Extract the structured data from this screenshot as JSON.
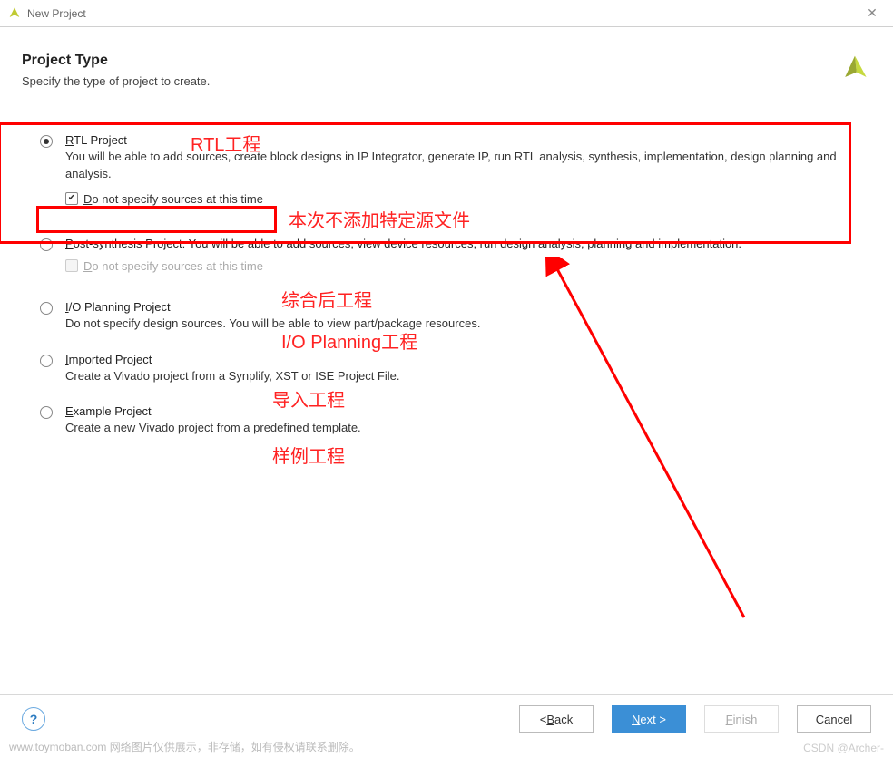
{
  "window": {
    "title": "New Project"
  },
  "header": {
    "title": "Project Type",
    "subtitle": "Specify the type of project to create."
  },
  "options": {
    "rtl": {
      "title_prefix": "R",
      "title_rest": "TL Project",
      "desc": "You will be able to add sources, create block designs in IP Integrator, generate IP, run RTL analysis, synthesis, implementation, design planning and analysis.",
      "checkbox_prefix": "D",
      "checkbox_rest": "o not specify sources at this time",
      "selected": true,
      "checked": true
    },
    "post": {
      "title_prefix": "P",
      "title_rest": "ost-synthesis Project: You will be able to add sources, view device resources, run design analysis, planning and implementation.",
      "checkbox_prefix": "D",
      "checkbox_rest": "o not specify sources at this time"
    },
    "io": {
      "title_prefix": "I",
      "title_rest": "/O Planning Project",
      "desc": "Do not specify design sources. You will be able to view part/package resources."
    },
    "imported": {
      "title_prefix": "I",
      "title_rest": "mported Project",
      "desc": "Create a Vivado project from a Synplify, XST or ISE Project File."
    },
    "example": {
      "title_prefix": "E",
      "title_rest": "xample Project",
      "desc": "Create a new Vivado project from a predefined template."
    }
  },
  "annotations": {
    "rtl": "RTL工程",
    "no_src": "本次不添加特定源文件",
    "post": "综合后工程",
    "io": "I/O Planning工程",
    "imported": "导入工程",
    "example": "样例工程"
  },
  "footer": {
    "help": "?",
    "back_prefix": "< ",
    "back_u": "B",
    "back_rest": "ack",
    "next_prefix": "",
    "next_u": "N",
    "next_rest": "ext >",
    "finish_u": "F",
    "finish_rest": "inish",
    "cancel": "Cancel"
  },
  "watermark": {
    "bottom": "www.toymoban.com 网络图片仅供展示，非存储，如有侵权请联系删除。",
    "csdn": "CSDN @Archer-"
  }
}
